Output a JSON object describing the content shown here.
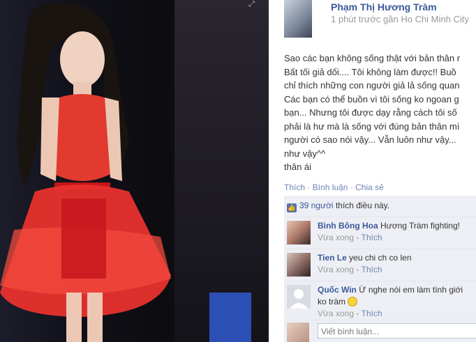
{
  "post": {
    "author": "Phạm Thị Hương Tràm",
    "timestamp": "1 phút trước gần Ho Chi Minh City",
    "lines": [
      "Sao các bạn không sống thật với bản thân r",
      "Bất tối giả dối.... Tôi không làm được!! Buồ",
      "chỉ thích những con người giả lả sống quan",
      "Các bạn có thể buồn vì tôi sống ko ngoan g",
      "bạn... Nhưng tôi được dạy rằng cách tôi số",
      "phải là hư mà là sống với đúng bản thân mì",
      "người có sao nói vậy... Vẫn luôn như vậy...",
      "như vậy^^",
      "thân ái"
    ]
  },
  "actions": {
    "like": "Thích",
    "comment": "Bình luận",
    "share": "Chia sẻ",
    "separator": "·"
  },
  "likes": {
    "count": "39 người",
    "text": "thích điều này."
  },
  "comments": [
    {
      "name": "Bình Bông Hoa",
      "text": "Hương Tràm fighting!",
      "time": "Vừa xong",
      "like": "Thích"
    },
    {
      "name": "Tien Le",
      "text": "yeu chi ch co len",
      "time": "Vừa xong",
      "like": "Thích"
    },
    {
      "name": "Quốc Win",
      "text": "Ừ nghe nói em làm tình giới",
      "text2": "ko tràm",
      "time": "Vừa xong",
      "like": "Thích"
    }
  ],
  "write_placeholder": "Viết bình luận...",
  "colors": {
    "link": "#3b5998",
    "muted": "#999999",
    "dress": "#e8312e"
  },
  "icons": {
    "expand": "expand-icon",
    "like": "thumbs-up-icon",
    "emoji": "smiley-icon"
  }
}
